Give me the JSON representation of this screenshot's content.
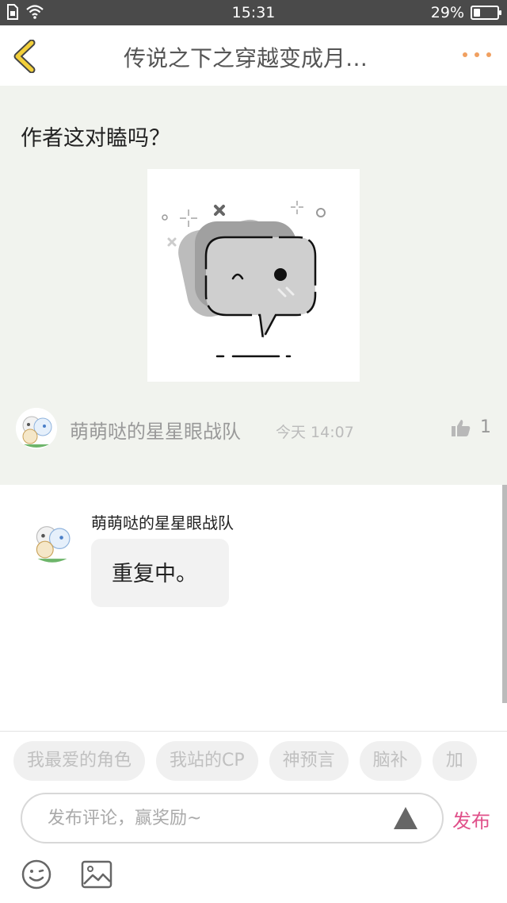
{
  "status_bar": {
    "time": "15:31",
    "battery_percent": "29%",
    "battery_level": 0.29,
    "icons": [
      "sim-icon",
      "wifi-icon",
      "battery-icon"
    ]
  },
  "header": {
    "title": "传说之下之穿越变成月…",
    "back_icon": "chevron-left-icon",
    "more_icon": "more-dots-icon",
    "accent_color": "#f0a060"
  },
  "post": {
    "text": "作者这对瞌吗？",
    "image_icon": "empty-comment-placeholder",
    "author": "萌萌哒的星星眼战队",
    "time": "今天 14:07",
    "likes": "1",
    "background": "#f1f3ee"
  },
  "reply": {
    "author": "萌萌哒的星星眼战队",
    "text": "重复中。"
  },
  "comment_bar": {
    "tags": [
      "我最爱的角色",
      "我站的CP",
      "神预言",
      "脑补",
      "加"
    ],
    "placeholder": "发布评论，赢奖励~",
    "publish_label": "发布",
    "publish_color": "#e0508a"
  }
}
